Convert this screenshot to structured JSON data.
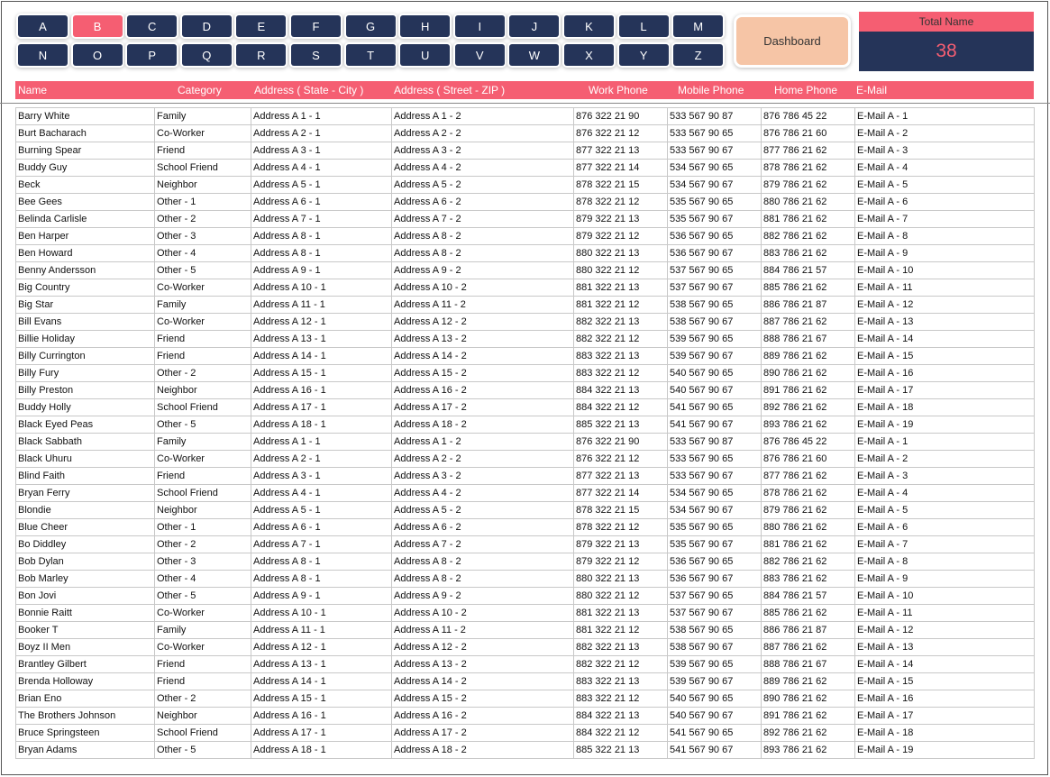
{
  "letters": [
    "A",
    "B",
    "C",
    "D",
    "E",
    "F",
    "G",
    "H",
    "I",
    "J",
    "K",
    "L",
    "M",
    "N",
    "O",
    "P",
    "Q",
    "R",
    "S",
    "T",
    "U",
    "V",
    "W",
    "X",
    "Y",
    "Z"
  ],
  "active_letter": "B",
  "dashboard_label": "Dashboard",
  "total": {
    "label": "Total Name",
    "value": "38"
  },
  "colors": {
    "navy": "#253459",
    "pink": "#f55e72",
    "peach": "#f6c5a6"
  },
  "columns": [
    "Name",
    "Category",
    "Address ( State - City )",
    "Address ( Street - ZIP )",
    "Work Phone",
    "Mobile Phone",
    "Home Phone",
    "E-Mail"
  ],
  "names": [
    "Barry White",
    "Burt Bacharach",
    "Burning Spear",
    "Buddy Guy",
    "Beck",
    "Bee Gees",
    "Belinda Carlisle",
    "Ben Harper",
    "Ben Howard",
    "Benny Andersson",
    "Big Country",
    "Big Star",
    "Bill Evans",
    "Billie Holiday",
    "Billy Currington",
    "Billy Fury",
    "Billy Preston",
    "Buddy Holly",
    "Black Eyed Peas",
    "Black Sabbath",
    "Black Uhuru",
    "Blind Faith",
    "Bryan Ferry",
    "Blondie",
    "Blue Cheer",
    "Bo Diddley",
    "Bob Dylan",
    "Bob Marley",
    "Bon Jovi",
    "Bonnie Raitt",
    "Booker T",
    "Boyz II Men",
    "Brantley Gilbert",
    "Brenda Holloway",
    "Brian Eno",
    "The Brothers Johnson",
    "Bruce Springsteen",
    "Bryan Adams"
  ],
  "pattern": [
    [
      "Family",
      "Address A 1 - 1",
      "Address A 1 - 2",
      "876 322 21 90",
      "533 567 90 87",
      "876 786 45 22",
      "E-Mail A - 1"
    ],
    [
      "Co-Worker",
      "Address A 2 - 1",
      "Address A 2 - 2",
      "876 322 21 12",
      "533 567 90 65",
      "876 786 21 60",
      "E-Mail A - 2"
    ],
    [
      "Friend",
      "Address A 3 - 1",
      "Address A 3 - 2",
      "877 322 21 13",
      "533 567 90 67",
      "877 786 21 62",
      "E-Mail A - 3"
    ],
    [
      "School Friend",
      "Address A 4 - 1",
      "Address A 4 - 2",
      "877 322 21 14",
      "534 567 90 65",
      "878 786 21 62",
      "E-Mail A - 4"
    ],
    [
      "Neighbor",
      "Address A 5 - 1",
      "Address A 5 - 2",
      "878 322 21 15",
      "534 567 90 67",
      "879 786 21 62",
      "E-Mail A - 5"
    ],
    [
      "Other - 1",
      "Address A 6 - 1",
      "Address A 6 - 2",
      "878 322 21 12",
      "535 567 90 65",
      "880 786 21 62",
      "E-Mail A - 6"
    ],
    [
      "Other - 2",
      "Address A 7 - 1",
      "Address A 7 - 2",
      "879 322 21 13",
      "535 567 90 67",
      "881 786 21 62",
      "E-Mail A - 7"
    ],
    [
      "Other - 3",
      "Address A 8 - 1",
      "Address A 8 - 2",
      "879 322 21 12",
      "536 567 90 65",
      "882 786 21 62",
      "E-Mail A - 8"
    ],
    [
      "Other - 4",
      "Address A 8 - 1",
      "Address A 8 - 2",
      "880 322 21 13",
      "536 567 90 67",
      "883 786 21 62",
      "E-Mail A - 9"
    ],
    [
      "Other - 5",
      "Address A 9 - 1",
      "Address A 9 - 2",
      "880 322 21 12",
      "537 567 90 65",
      "884 786 21 57",
      "E-Mail A - 10"
    ],
    [
      "Co-Worker",
      "Address A 10 - 1",
      "Address A 10 - 2",
      "881 322 21 13",
      "537 567 90 67",
      "885 786 21 62",
      "E-Mail A - 11"
    ],
    [
      "Family",
      "Address A 11 - 1",
      "Address A 11 - 2",
      "881 322 21 12",
      "538 567 90 65",
      "886 786 21 87",
      "E-Mail A - 12"
    ],
    [
      "Co-Worker",
      "Address A 12 - 1",
      "Address A 12 - 2",
      "882 322 21 13",
      "538 567 90 67",
      "887 786 21 62",
      "E-Mail A - 13"
    ],
    [
      "Friend",
      "Address A 13 - 1",
      "Address A 13 - 2",
      "882 322 21 12",
      "539 567 90 65",
      "888 786 21 67",
      "E-Mail A - 14"
    ],
    [
      "Friend",
      "Address A 14 - 1",
      "Address A 14 - 2",
      "883 322 21 13",
      "539 567 90 67",
      "889 786 21 62",
      "E-Mail A - 15"
    ],
    [
      "Other - 2",
      "Address A 15 - 1",
      "Address A 15 - 2",
      "883 322 21 12",
      "540 567 90 65",
      "890 786 21 62",
      "E-Mail A - 16"
    ],
    [
      "Neighbor",
      "Address A 16 - 1",
      "Address A 16 - 2",
      "884 322 21 13",
      "540 567 90 67",
      "891 786 21 62",
      "E-Mail A - 17"
    ],
    [
      "School Friend",
      "Address A 17 - 1",
      "Address A 17 - 2",
      "884 322 21 12",
      "541 567 90 65",
      "892 786 21 62",
      "E-Mail A - 18"
    ],
    [
      "Other - 5",
      "Address A 18 - 1",
      "Address A 18 - 2",
      "885 322 21 13",
      "541 567 90 67",
      "893 786 21 62",
      "E-Mail A - 19"
    ]
  ]
}
